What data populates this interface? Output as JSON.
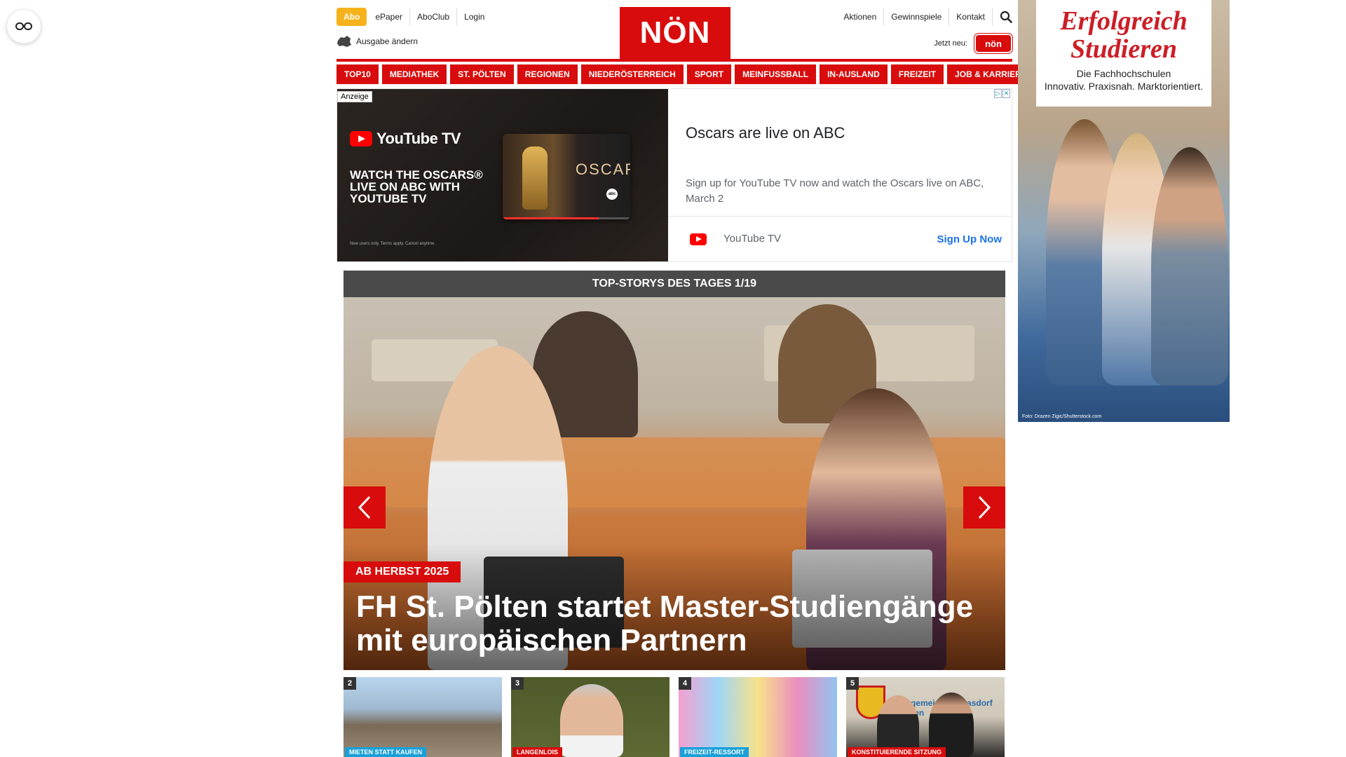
{
  "page": {
    "background": "#ffffff",
    "brand_color": "#d80c0c"
  },
  "side_button": {
    "icon": "glasses-icon"
  },
  "header": {
    "abo_label": "Abo",
    "top_links": [
      "ePaper",
      "AboClub",
      "Login"
    ],
    "edition_label": "Ausgabe ändern",
    "logo_text": "NÖN",
    "right_links": [
      "Aktionen",
      "Gewinnspiele",
      "Kontakt"
    ],
    "jetzt_label": "Jetzt neu:",
    "jetzt_logo_text": "nön"
  },
  "nav": {
    "items": [
      "TOP10",
      "MEDIATHEK",
      "ST. PÖLTEN",
      "REGIONEN",
      "NIEDERÖSTERREICH",
      "SPORT",
      "MEINFUSSBALL",
      "IN-AUSLAND",
      "FREIZEIT",
      "JOB & KARRIERE"
    ]
  },
  "ad": {
    "label": "Anzeige",
    "brand": "YouTube TV",
    "headline": "WATCH THE OSCARS® LIVE ON ABC WITH YOUTUBE TV",
    "small_print": "New users only. Terms apply. Cancel anytime.",
    "card_word": "OSCARS",
    "card_badge": "abc",
    "title": "Oscars are live on ABC",
    "description": "Sign up for YouTube TV now and watch the Oscars live on ABC, March 2",
    "advertiser": "YouTube TV",
    "cta": "Sign Up Now"
  },
  "slider": {
    "heading": "TOP-STORYS DES TAGES 1/19",
    "kicker": "AB HERBST 2025",
    "headline": "FH St. Pölten startet Master-Studiengänge mit europäischen Partnern"
  },
  "cards": [
    {
      "num": "2",
      "tag": "MIETEN STATT KAUFEN",
      "tag_color": "#1aa0d8"
    },
    {
      "num": "3",
      "tag": "LANGENLOIS",
      "tag_color": "#d80c0c"
    },
    {
      "num": "4",
      "tag": "FREIZEIT-RESSORT",
      "tag_color": "#1aa0d8"
    },
    {
      "num": "5",
      "tag": "KONSTITUIERENDE SITZUNG",
      "tag_color": "#d80c0c",
      "sign_text": "Stadtgemeinde Gerasdorf bei Wien"
    }
  ],
  "sky_ad": {
    "title_line1": "Erfolgreich",
    "title_line2": "Studieren",
    "sub_line1": "Die Fachhochschulen",
    "sub_line2": "Innovativ. Praxisnah. Marktorientiert.",
    "credit": "Foto: Drazen Zigic/Shutterstock.com"
  }
}
